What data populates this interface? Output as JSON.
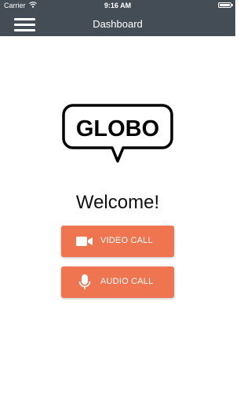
{
  "status_bar": {
    "carrier": "Carrier",
    "time": "9:16 AM",
    "wifi_icon": "wifi-icon",
    "battery_icon": "battery-icon"
  },
  "nav": {
    "title": "Dashboard",
    "menu_icon": "hamburger-menu-icon"
  },
  "logo": {
    "text": "GLOBO",
    "shape": "speech-bubble"
  },
  "welcome": "Welcome!",
  "buttons": {
    "video_call": "VIDEO CALL",
    "video_icon": "video-camera-icon",
    "audio_call": "AUDIO CALL",
    "audio_icon": "microphone-icon"
  },
  "colors": {
    "bar_background": "#444d56",
    "accent": "#ef7550",
    "text_on_bar": "#ffffff"
  }
}
